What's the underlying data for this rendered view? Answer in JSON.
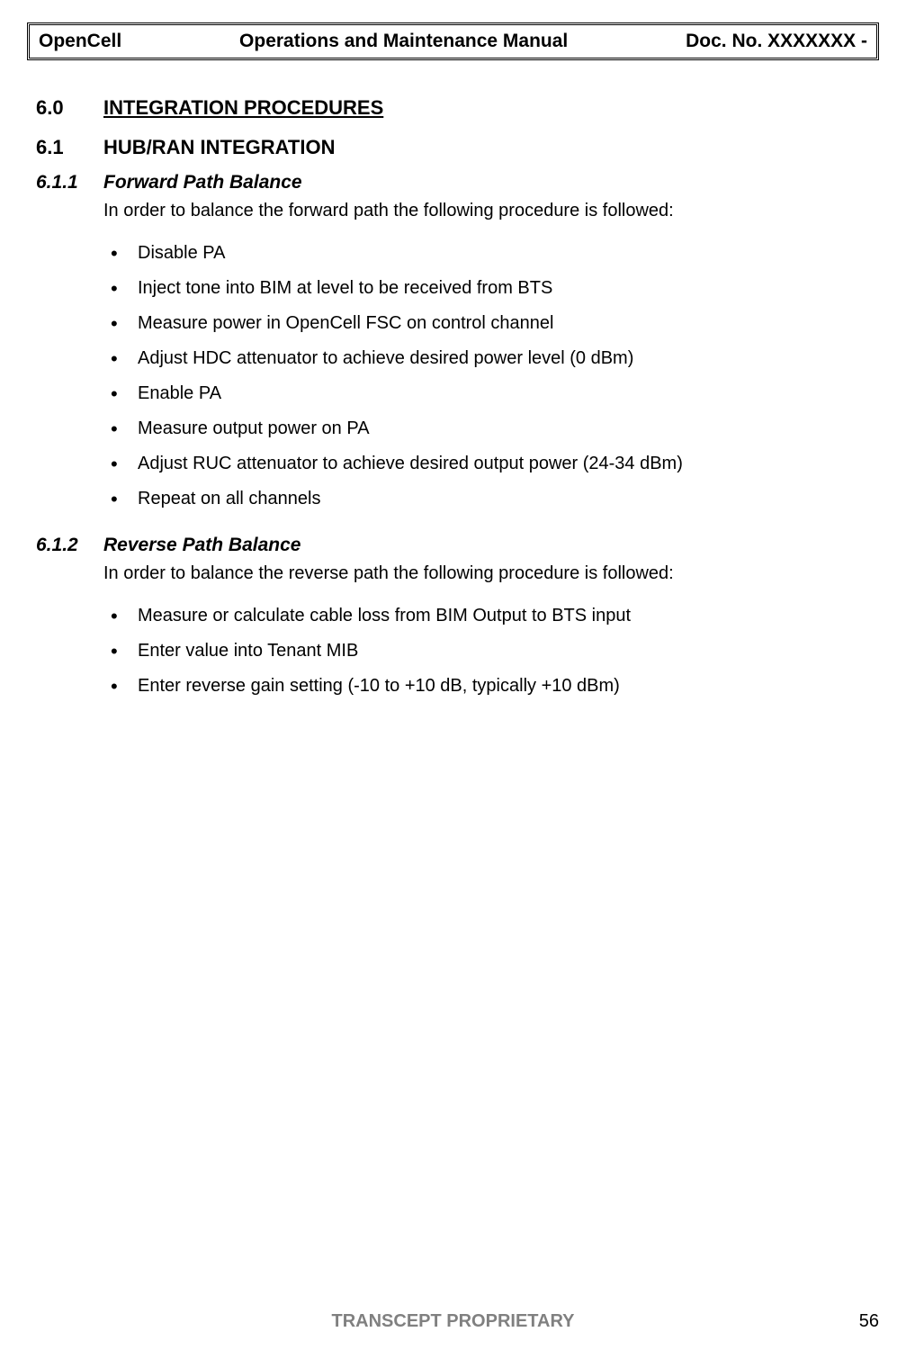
{
  "header": {
    "left": "OpenCell",
    "center": "Operations and Maintenance Manual",
    "right": "Doc. No.  XXXXXXX -"
  },
  "sections": {
    "s60": {
      "num": "6.0",
      "title": "INTEGRATION PROCEDURES"
    },
    "s61": {
      "num": "6.1",
      "title": "HUB/RAN INTEGRATION"
    },
    "s611": {
      "num": "6.1.1",
      "title": "Forward Path Balance",
      "intro": "In order to balance the forward path the following procedure is followed:",
      "items": [
        "Disable PA",
        "Inject tone into BIM at level to be received from BTS",
        "Measure power in OpenCell FSC on control channel",
        "Adjust HDC attenuator to achieve desired power level (0 dBm)",
        "Enable PA",
        "Measure output power on PA",
        "Adjust RUC attenuator to achieve desired output power (24-34 dBm)",
        "Repeat on all channels"
      ]
    },
    "s612": {
      "num": "6.1.2",
      "title": "Reverse Path Balance",
      "intro": "In order to balance the reverse path the following procedure is followed:",
      "items": [
        "Measure or calculate cable loss from BIM Output to BTS input",
        "Enter value into Tenant MIB",
        "Enter reverse gain setting (-10 to +10 dB, typically +10 dBm)"
      ]
    }
  },
  "footer": {
    "center": "TRANSCEPT PROPRIETARY",
    "page": "56"
  }
}
